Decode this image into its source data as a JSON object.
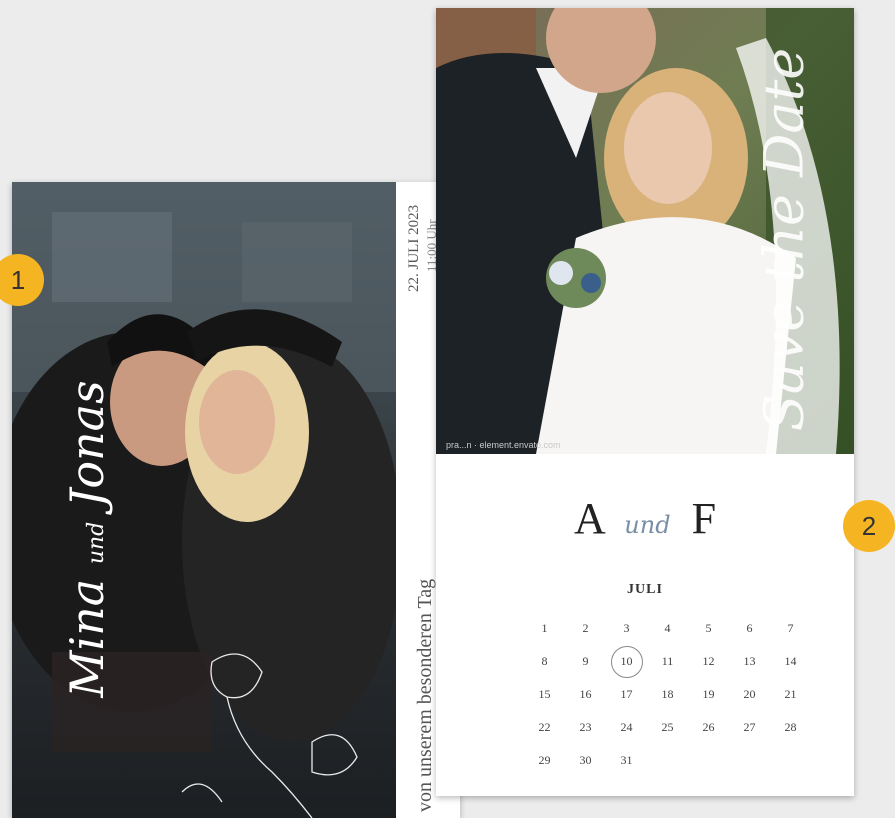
{
  "card1": {
    "names_part1": "Mina",
    "names_and": "und",
    "names_part2": "Jonas",
    "date": "22. JULI 2023",
    "time": "11:00 Uhr",
    "tagline": "von unserem  besonderen Tag"
  },
  "card2": {
    "save_the_date": "Save the Date",
    "credit": "pra...n · element.envato.com",
    "monogram_left": "A",
    "monogram_and": "und",
    "monogram_right": "F",
    "month": "JULI",
    "days": [
      "1",
      "2",
      "3",
      "4",
      "5",
      "6",
      "7",
      "8",
      "9",
      "10",
      "11",
      "12",
      "13",
      "14",
      "15",
      "16",
      "17",
      "18",
      "19",
      "20",
      "21",
      "22",
      "23",
      "24",
      "25",
      "26",
      "27",
      "28",
      "29",
      "30",
      "31"
    ],
    "highlighted_day": "10"
  },
  "badges": {
    "one": "1",
    "two": "2",
    "color": "#f5b522"
  }
}
